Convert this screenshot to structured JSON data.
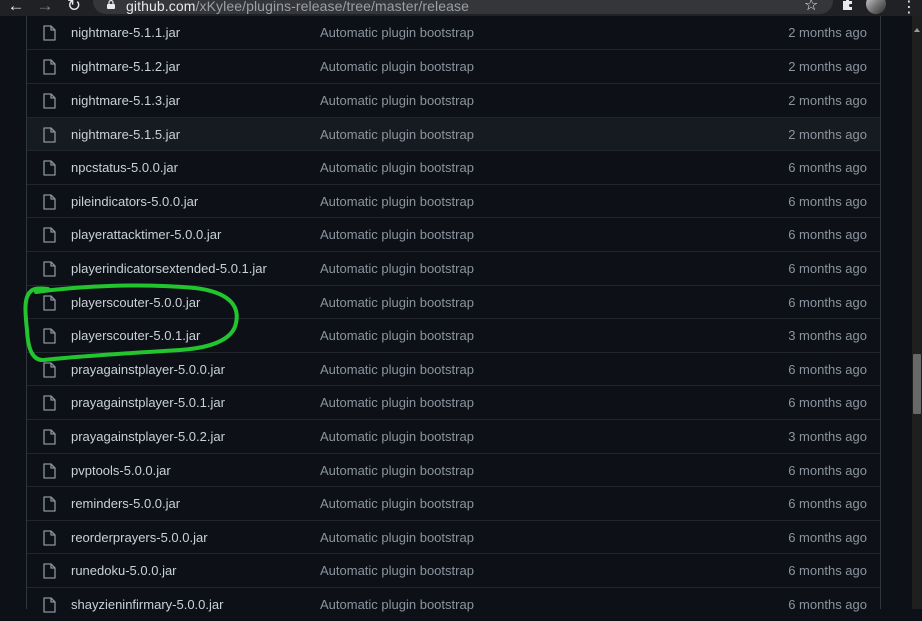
{
  "browser": {
    "url_domain": "github.com",
    "url_path": "/xKylee/plugins-release/tree/master/release"
  },
  "files": [
    {
      "name": "nightmare-5.1.1.jar",
      "commit": "Automatic plugin bootstrap",
      "age": "2 months ago"
    },
    {
      "name": "nightmare-5.1.2.jar",
      "commit": "Automatic plugin bootstrap",
      "age": "2 months ago"
    },
    {
      "name": "nightmare-5.1.3.jar",
      "commit": "Automatic plugin bootstrap",
      "age": "2 months ago"
    },
    {
      "name": "nightmare-5.1.5.jar",
      "commit": "Automatic plugin bootstrap",
      "age": "2 months ago"
    },
    {
      "name": "npcstatus-5.0.0.jar",
      "commit": "Automatic plugin bootstrap",
      "age": "6 months ago"
    },
    {
      "name": "pileindicators-5.0.0.jar",
      "commit": "Automatic plugin bootstrap",
      "age": "6 months ago"
    },
    {
      "name": "playerattacktimer-5.0.0.jar",
      "commit": "Automatic plugin bootstrap",
      "age": "6 months ago"
    },
    {
      "name": "playerindicatorsextended-5.0.1.jar",
      "commit": "Automatic plugin bootstrap",
      "age": "6 months ago"
    },
    {
      "name": "playerscouter-5.0.0.jar",
      "commit": "Automatic plugin bootstrap",
      "age": "6 months ago"
    },
    {
      "name": "playerscouter-5.0.1.jar",
      "commit": "Automatic plugin bootstrap",
      "age": "3 months ago"
    },
    {
      "name": "prayagainstplayer-5.0.0.jar",
      "commit": "Automatic plugin bootstrap",
      "age": "6 months ago"
    },
    {
      "name": "prayagainstplayer-5.0.1.jar",
      "commit": "Automatic plugin bootstrap",
      "age": "6 months ago"
    },
    {
      "name": "prayagainstplayer-5.0.2.jar",
      "commit": "Automatic plugin bootstrap",
      "age": "3 months ago"
    },
    {
      "name": "pvptools-5.0.0.jar",
      "commit": "Automatic plugin bootstrap",
      "age": "6 months ago"
    },
    {
      "name": "reminders-5.0.0.jar",
      "commit": "Automatic plugin bootstrap",
      "age": "6 months ago"
    },
    {
      "name": "reorderprayers-5.0.0.jar",
      "commit": "Automatic plugin bootstrap",
      "age": "6 months ago"
    },
    {
      "name": "runedoku-5.0.0.jar",
      "commit": "Automatic plugin bootstrap",
      "age": "6 months ago"
    },
    {
      "name": "shayzieninfirmary-5.0.0.jar",
      "commit": "Automatic plugin bootstrap",
      "age": "6 months ago"
    }
  ],
  "hovered_row_index": 3,
  "annotation": {
    "color": "#22c52e",
    "circled_rows": [
      8,
      9
    ]
  }
}
